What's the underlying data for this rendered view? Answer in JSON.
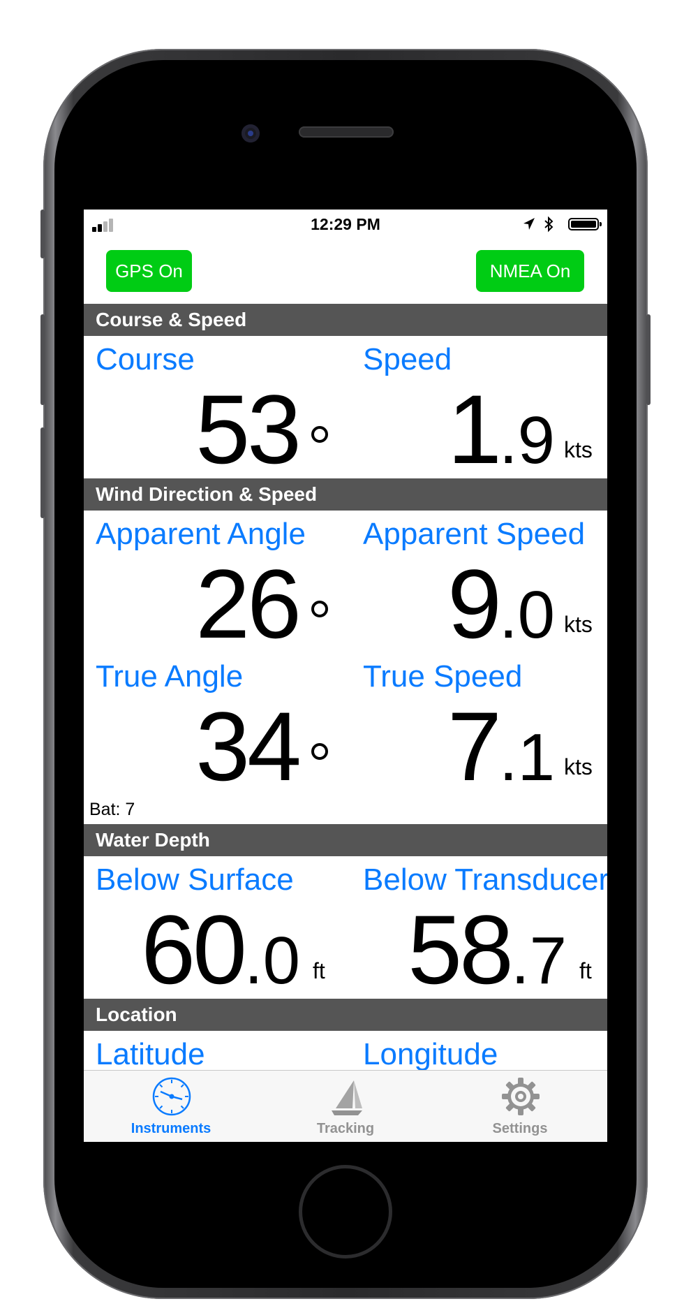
{
  "status_bar": {
    "time": "12:29 PM"
  },
  "controls": {
    "gps_button": "GPS On",
    "nmea_button": "NMEA On"
  },
  "sections": {
    "course_speed": {
      "title": "Course & Speed",
      "course": {
        "label": "Course",
        "value": "53",
        "unit": "°"
      },
      "speed": {
        "label": "Speed",
        "whole": "1",
        "decimal": ".9",
        "unit": "kts"
      }
    },
    "wind": {
      "title": "Wind Direction & Speed",
      "apparent_angle": {
        "label": "Apparent Angle",
        "value": "26",
        "unit": "°"
      },
      "apparent_speed": {
        "label": "Apparent Speed",
        "whole": "9",
        "decimal": ".0",
        "unit": "kts"
      },
      "true_angle": {
        "label": "True Angle",
        "value": "34",
        "unit": "°"
      },
      "true_speed": {
        "label": "True Speed",
        "whole": "7",
        "decimal": ".1",
        "unit": "kts"
      },
      "battery": "Bat: 7"
    },
    "depth": {
      "title": "Water Depth",
      "below_surface": {
        "label": "Below Surface",
        "whole": "60",
        "decimal": ".0",
        "unit": "ft"
      },
      "below_transducer": {
        "label": "Below Transducer",
        "whole": "58",
        "decimal": ".7",
        "unit": "ft"
      }
    },
    "location": {
      "title": "Location",
      "latitude_label": "Latitude",
      "longitude_label": "Longitude"
    }
  },
  "tab_bar": {
    "active_color": "#0a7bff",
    "inactive_color": "#929292",
    "tabs": [
      {
        "label": "Instruments",
        "icon": "gauge-icon",
        "active": true
      },
      {
        "label": "Tracking",
        "icon": "sailboat-icon",
        "active": false
      },
      {
        "label": "Settings",
        "icon": "gear-icon",
        "active": false
      }
    ]
  },
  "colors": {
    "accent": "#0a7bff",
    "header": "#555555",
    "button_green": "#00cc14"
  }
}
